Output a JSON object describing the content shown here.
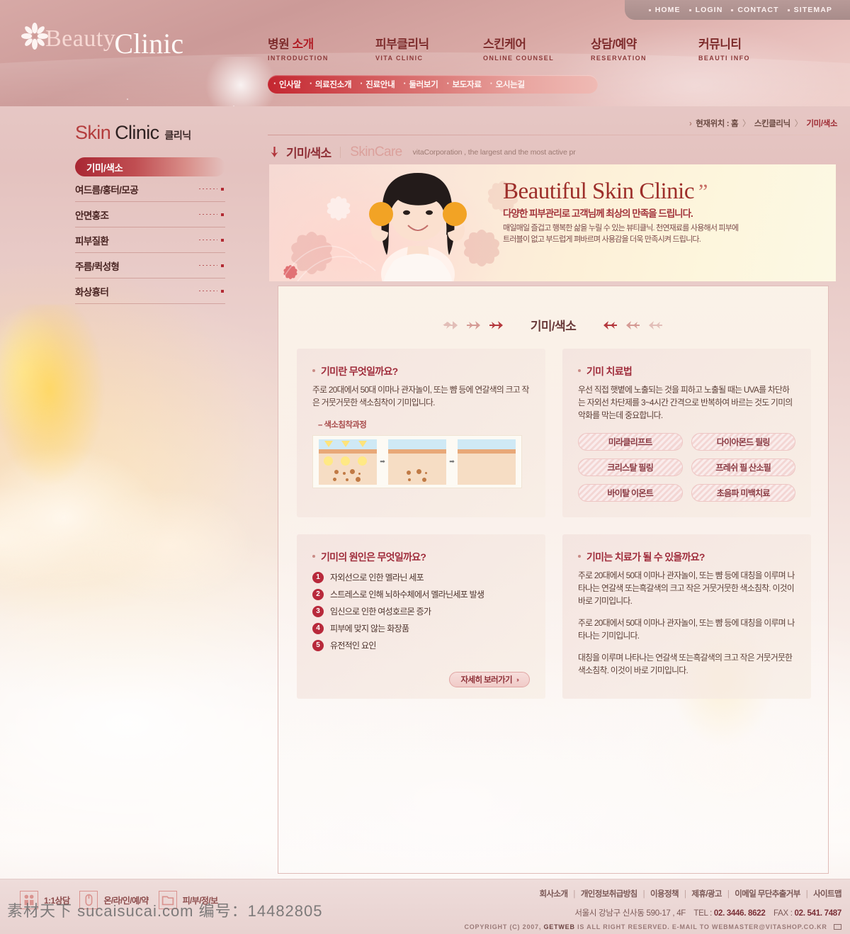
{
  "utility_nav": [
    {
      "label": "HOME"
    },
    {
      "label": "LOGIN"
    },
    {
      "label": "CONTACT"
    },
    {
      "label": "SITEMAP"
    }
  ],
  "logo": {
    "word1": "Beauty",
    "word2": "Clinic",
    "icon": "flower-icon"
  },
  "main_nav": [
    {
      "ko_prefix": "병원 ",
      "ko_highlight": "소개",
      "en": "INTRODUCTION",
      "active": true
    },
    {
      "ko_prefix": "피부클리닉",
      "ko_highlight": "",
      "en": "VITA CLINIC",
      "active": false
    },
    {
      "ko_prefix": "스킨케어",
      "ko_highlight": "",
      "en": "ONLINE COUNSEL",
      "active": false
    },
    {
      "ko_prefix": "상담/예약",
      "ko_highlight": "",
      "en": "RESERVATION",
      "active": false
    },
    {
      "ko_prefix": "커뮤니티",
      "ko_highlight": "",
      "en": "BEAUTI INFO",
      "active": false
    }
  ],
  "sub_nav": [
    {
      "label": "인사말"
    },
    {
      "label": "의료진소개"
    },
    {
      "label": "진료안내"
    },
    {
      "label": "둘러보기"
    },
    {
      "label": "보도자료"
    },
    {
      "label": "오시는길"
    }
  ],
  "sidebar": {
    "title_en1": "Skin",
    "title_en2": "Clinic",
    "title_ko": "클리닉",
    "active_item": "기미/색소",
    "items": [
      {
        "label": "여드름/홍터/모공"
      },
      {
        "label": "안면홍조"
      },
      {
        "label": "피부질환"
      },
      {
        "label": "주름/퀵성형"
      },
      {
        "label": "화상흉터"
      }
    ]
  },
  "breadcrumb": {
    "lead": "현재위치 :",
    "home": "홈",
    "section": "스킨클리닉",
    "current": "기미/색소"
  },
  "page_head": {
    "ko": "기미/색소",
    "en": "SkinCare",
    "sub": "vitaCorporation , the largest and the most active pr"
  },
  "hero": {
    "title": "Beautiful Skin Clinic",
    "quote_mark": "”",
    "subtitle": "다양한 피부관리로 고객님께 최상의 만족을 드립니다.",
    "body_line1": "매일매일 즐겁고 행복한 삶을 누릴 수 있는 뷰티클닉. 천연재료를 사용해서 피부에",
    "body_line2": "트러블이 없고 부드럽게 펴바르며 사용감을 더욱 만족시켜 드립니다."
  },
  "section_title": "기미/색소",
  "cards": {
    "what_is": {
      "title": "기미란 무엇일까요?",
      "body": "주로 20대에서 50대 이마나 관자놀이, 또는 뺨 등에 연갈색의 크고 작은 거뭇거뭇한 색소침착이 기미입니다.",
      "sub_label": "– 색소침착과정"
    },
    "treatment": {
      "title": "기미 치료법",
      "body": "우선 직접 햇볕에 노출되는 것을 피하고 노출될 때는 UVA를 차단하는 자외선 차단제를 3~4시간 간격으로 반복하여 바르는 것도 기미의 악화를 막는데 중요합니다.",
      "buttons": [
        {
          "label": "미라클리프트"
        },
        {
          "label": "다이아몬드 필링"
        },
        {
          "label": "크리스탈 필링"
        },
        {
          "label": "프레쉬 필 산소필"
        },
        {
          "label": "바이탈 이온트"
        },
        {
          "label": "초음파 미백치료"
        }
      ]
    },
    "causes": {
      "title": "기미의 원인은 무엇일까요?",
      "items": [
        {
          "num": "1",
          "label": "자외선으로 인한 멜라닌 세포"
        },
        {
          "num": "2",
          "label": "스트레스로 인해 뇌하수체에서 멜라닌세포 발생"
        },
        {
          "num": "3",
          "label": "임신으로 인한 여성호르몬 증가"
        },
        {
          "num": "4",
          "label": "피부에 맞지 않는 화장품"
        },
        {
          "num": "5",
          "label": "유전적인 요인"
        }
      ],
      "more_label": "자세히 보러가기",
      "more_chevron": "››"
    },
    "curable": {
      "title": "기미는 치료가 될 수 있을까요?",
      "p1": "주로 20대에서 50대 이마나 관자놀이, 또는 뺨 등에 대칭을 이루며 나타나는 연갈색 또는흑갈색의 크고 작은 거뭇거뭇한 색소침착. 이것이 바로 기미입니다.",
      "p2": "주로 20대에서 50대 이마나 관자놀이, 또는 뺨 등에 대칭을 이루며 나타나는 기미입니다.",
      "p3": "대칭을 이루며 나타나는 연갈색 또는흑갈색의 크고 작은 거뭇거뭇한 색소침착. 이것이 바로 기미입니다."
    }
  },
  "footer": {
    "quick_icons": [
      {
        "icon": "people-icon",
        "label": "1:1상담"
      },
      {
        "icon": "mouse-icon",
        "label": "온/라/인/예/약"
      },
      {
        "icon": "folder-icon",
        "label": "피/부/정/보"
      }
    ],
    "links": [
      {
        "label": "회사소개"
      },
      {
        "label": "개인정보취급방침"
      },
      {
        "label": "이용정책"
      },
      {
        "label": "제휴/광고"
      },
      {
        "label": "이메일 무단추출거부"
      },
      {
        "label": "사이트맵"
      }
    ],
    "address": "서울시 강남구 신사동 590-17 , 4F",
    "tel_label": "TEL :",
    "tel": "02. 3446. 8622",
    "fax_label": "FAX :",
    "fax": "02. 541. 7487",
    "copyright_pre": "COPYRIGHT (C) 2007,",
    "copyright_brand": "GETWEB",
    "copyright_post": "IS ALL RIGHT RESERVED. E-MAIL TO WEBMASTER@VITASHOP.CO.KR"
  },
  "watermark": "素材天下 sucaisucai.com 编号：14482805",
  "colors": {
    "accent_red": "#b01d25",
    "deep_red": "#9d2e2a",
    "header_pink": "#d7a9a6",
    "pill_pink": "#f3d6d4"
  }
}
